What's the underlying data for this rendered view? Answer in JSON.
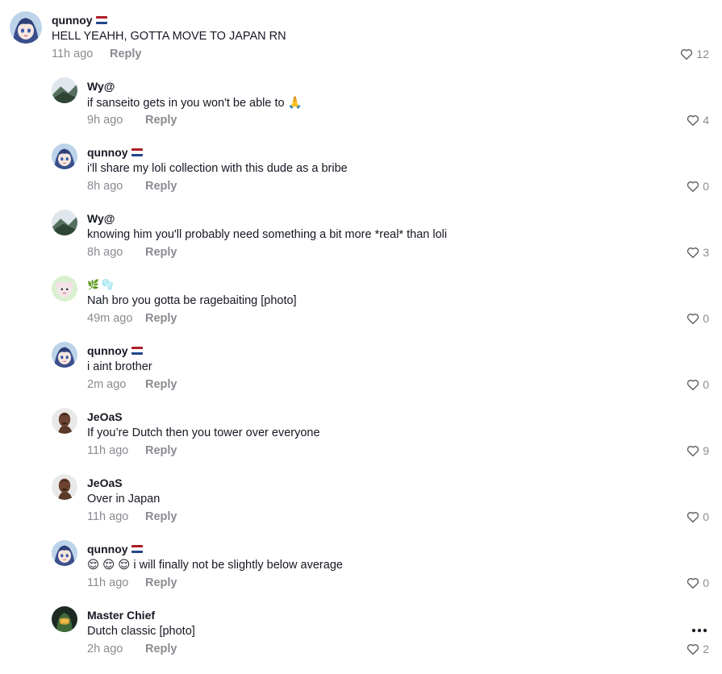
{
  "comments": [
    {
      "name": "qunnoy",
      "flag": true,
      "text": "HELL YEAHH, GOTTA MOVE TO JAPAN RN",
      "time": "11h ago",
      "reply": "Reply",
      "likes": "12",
      "level": "top",
      "avatar": "anime-avatar"
    },
    {
      "name": "Wy@",
      "flag": false,
      "text": "if sanseito gets in you won't be able to 🙏",
      "time": "9h ago",
      "reply": "Reply",
      "likes": "4",
      "level": "reply",
      "avatar": "landscape-avatar"
    },
    {
      "name": "qunnoy",
      "flag": true,
      "text": "i'll share my loli collection with this dude as a bribe",
      "time": "8h ago",
      "reply": "Reply",
      "likes": "0",
      "level": "reply",
      "avatar": "anime-avatar"
    },
    {
      "name": "Wy@",
      "flag": false,
      "text": "knowing him you'll probably need something a bit more *real* than loli",
      "time": "8h ago",
      "reply": "Reply",
      "likes": "3",
      "level": "reply",
      "avatar": "landscape-avatar"
    },
    {
      "name": "🌿 🫧",
      "flag": false,
      "text": "Nah bro you gotta be ragebaiting [photo]",
      "time": "49m ago",
      "reply": "Reply",
      "likes": "0",
      "level": "reply",
      "avatar": "sheep-avatar"
    },
    {
      "name": "qunnoy",
      "flag": true,
      "text": "i aint brother",
      "time": "2m ago",
      "reply": "Reply",
      "likes": "0",
      "level": "reply",
      "avatar": "anime-avatar"
    },
    {
      "name": "JeOaS",
      "flag": false,
      "text": "If you’re Dutch then you tower over everyone",
      "time": "11h ago",
      "reply": "Reply",
      "likes": "9",
      "level": "reply",
      "avatar": "person-avatar"
    },
    {
      "name": "JeOaS",
      "flag": false,
      "text": "Over in Japan",
      "time": "11h ago",
      "reply": "Reply",
      "likes": "0",
      "level": "reply",
      "avatar": "person-avatar"
    },
    {
      "name": "qunnoy",
      "flag": true,
      "text": "😌 😌 😌  i will finally not be slightly below average",
      "time": "11h ago",
      "reply": "Reply",
      "likes": "0",
      "level": "reply",
      "avatar": "anime-avatar"
    },
    {
      "name": "Master Chief",
      "flag": false,
      "text": "Dutch classic [photo]",
      "time": "2h ago",
      "reply": "Reply",
      "likes": "2",
      "level": "reply",
      "avatar": "helmet-avatar",
      "more": true
    }
  ],
  "colors": {
    "flag_red": "#ae1c28",
    "flag_white": "#ffffff",
    "flag_blue": "#21468b",
    "meta": "#8a8b91"
  }
}
